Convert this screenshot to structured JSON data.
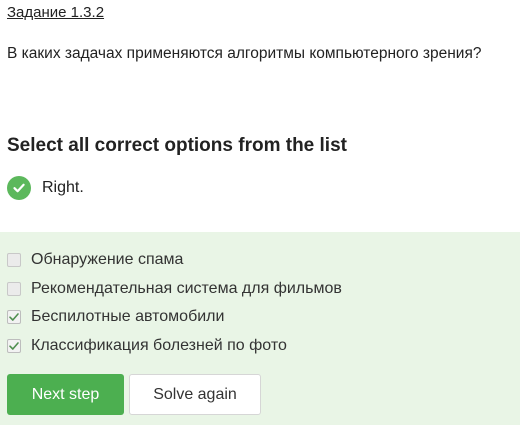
{
  "task": {
    "link_text": "Задание 1.3.2"
  },
  "question": {
    "text": "В каких задачах применяются алгоритмы компьютерного зрения?"
  },
  "instruction": {
    "text": "Select all correct options from the list"
  },
  "result": {
    "icon": "checkmark-circle-icon",
    "text": "Right."
  },
  "options": [
    {
      "label": "Обнаружение спама",
      "checked": false
    },
    {
      "label": "Рекомендательная система для фильмов",
      "checked": false
    },
    {
      "label": "Беспилотные автомобили",
      "checked": true
    },
    {
      "label": "Классификация болезней по фото",
      "checked": true
    }
  ],
  "buttons": {
    "next_label": "Next step",
    "solve_again_label": "Solve again"
  },
  "colors": {
    "accent": "#4caf50",
    "success_icon": "#5cb85c",
    "panel_background": "#e9f5e6",
    "checkmark": "#4f8f4f"
  }
}
